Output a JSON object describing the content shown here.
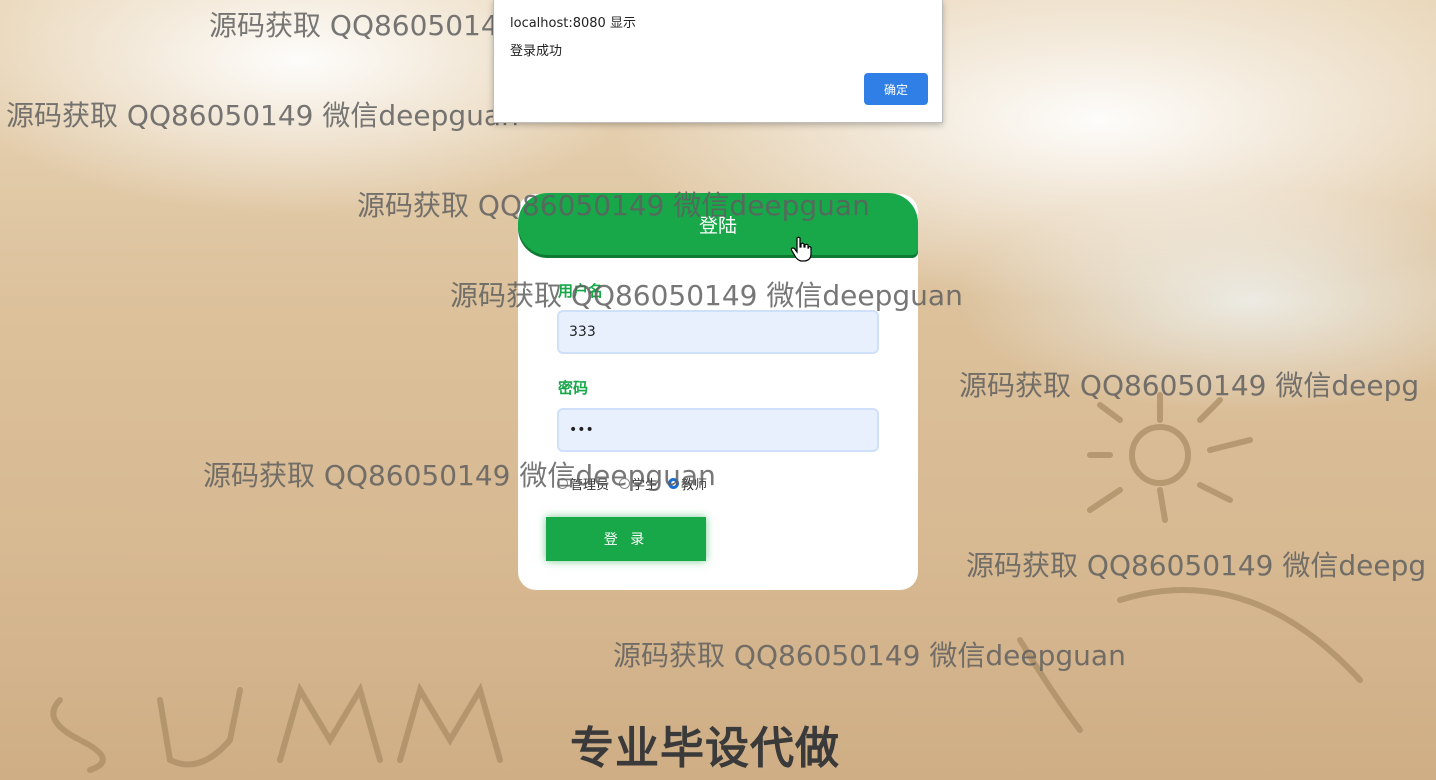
{
  "dialog": {
    "origin": "localhost:8080 显示",
    "message": "登录成功",
    "ok_label": "确定"
  },
  "login": {
    "header": "登陆",
    "username_label": "用户名",
    "username_value": "333",
    "password_label": "密码",
    "password_value": "•••",
    "roles": [
      {
        "label": "管理员",
        "checked": false
      },
      {
        "label": "学生",
        "checked": false
      },
      {
        "label": "教师",
        "checked": true
      }
    ],
    "submit_label": "登 录"
  },
  "watermarks": [
    "源码获取 QQ86050149 微信deepguan",
    "源码获取 QQ86050149 微信deepguan",
    "源码获取 QQ86050149 微信deepguan",
    "源码获取 QQ86050149 微信deepguan",
    "源码获取 QQ86050149 微信deepg",
    "源码获取 QQ86050149 微信deepguan",
    "源码获取 QQ86050149 微信deepg",
    "源码获取 QQ86050149 微信deepguan"
  ],
  "caption": "专业毕设代做",
  "colors": {
    "accent": "#18a84a",
    "dialog_button": "#2f7fe6"
  }
}
